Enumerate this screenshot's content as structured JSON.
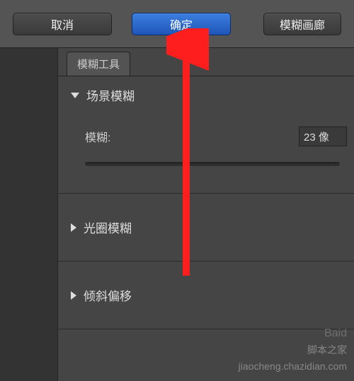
{
  "topbar": {
    "cancel_label": "取消",
    "confirm_label": "确定",
    "gallery_label": "模糊画廊"
  },
  "panel": {
    "tab_label": "模糊工具"
  },
  "sections": {
    "field_blur": {
      "title": "场景模糊",
      "blur_label": "模糊:",
      "blur_value": "23 像"
    },
    "iris_blur": {
      "title": "光圈模糊"
    },
    "tilt_shift": {
      "title": "倾斜偏移"
    }
  },
  "watermark": {
    "line1": "Baid",
    "line2": "脚本之家",
    "line3": "jiaocheng.chazidian.com"
  }
}
